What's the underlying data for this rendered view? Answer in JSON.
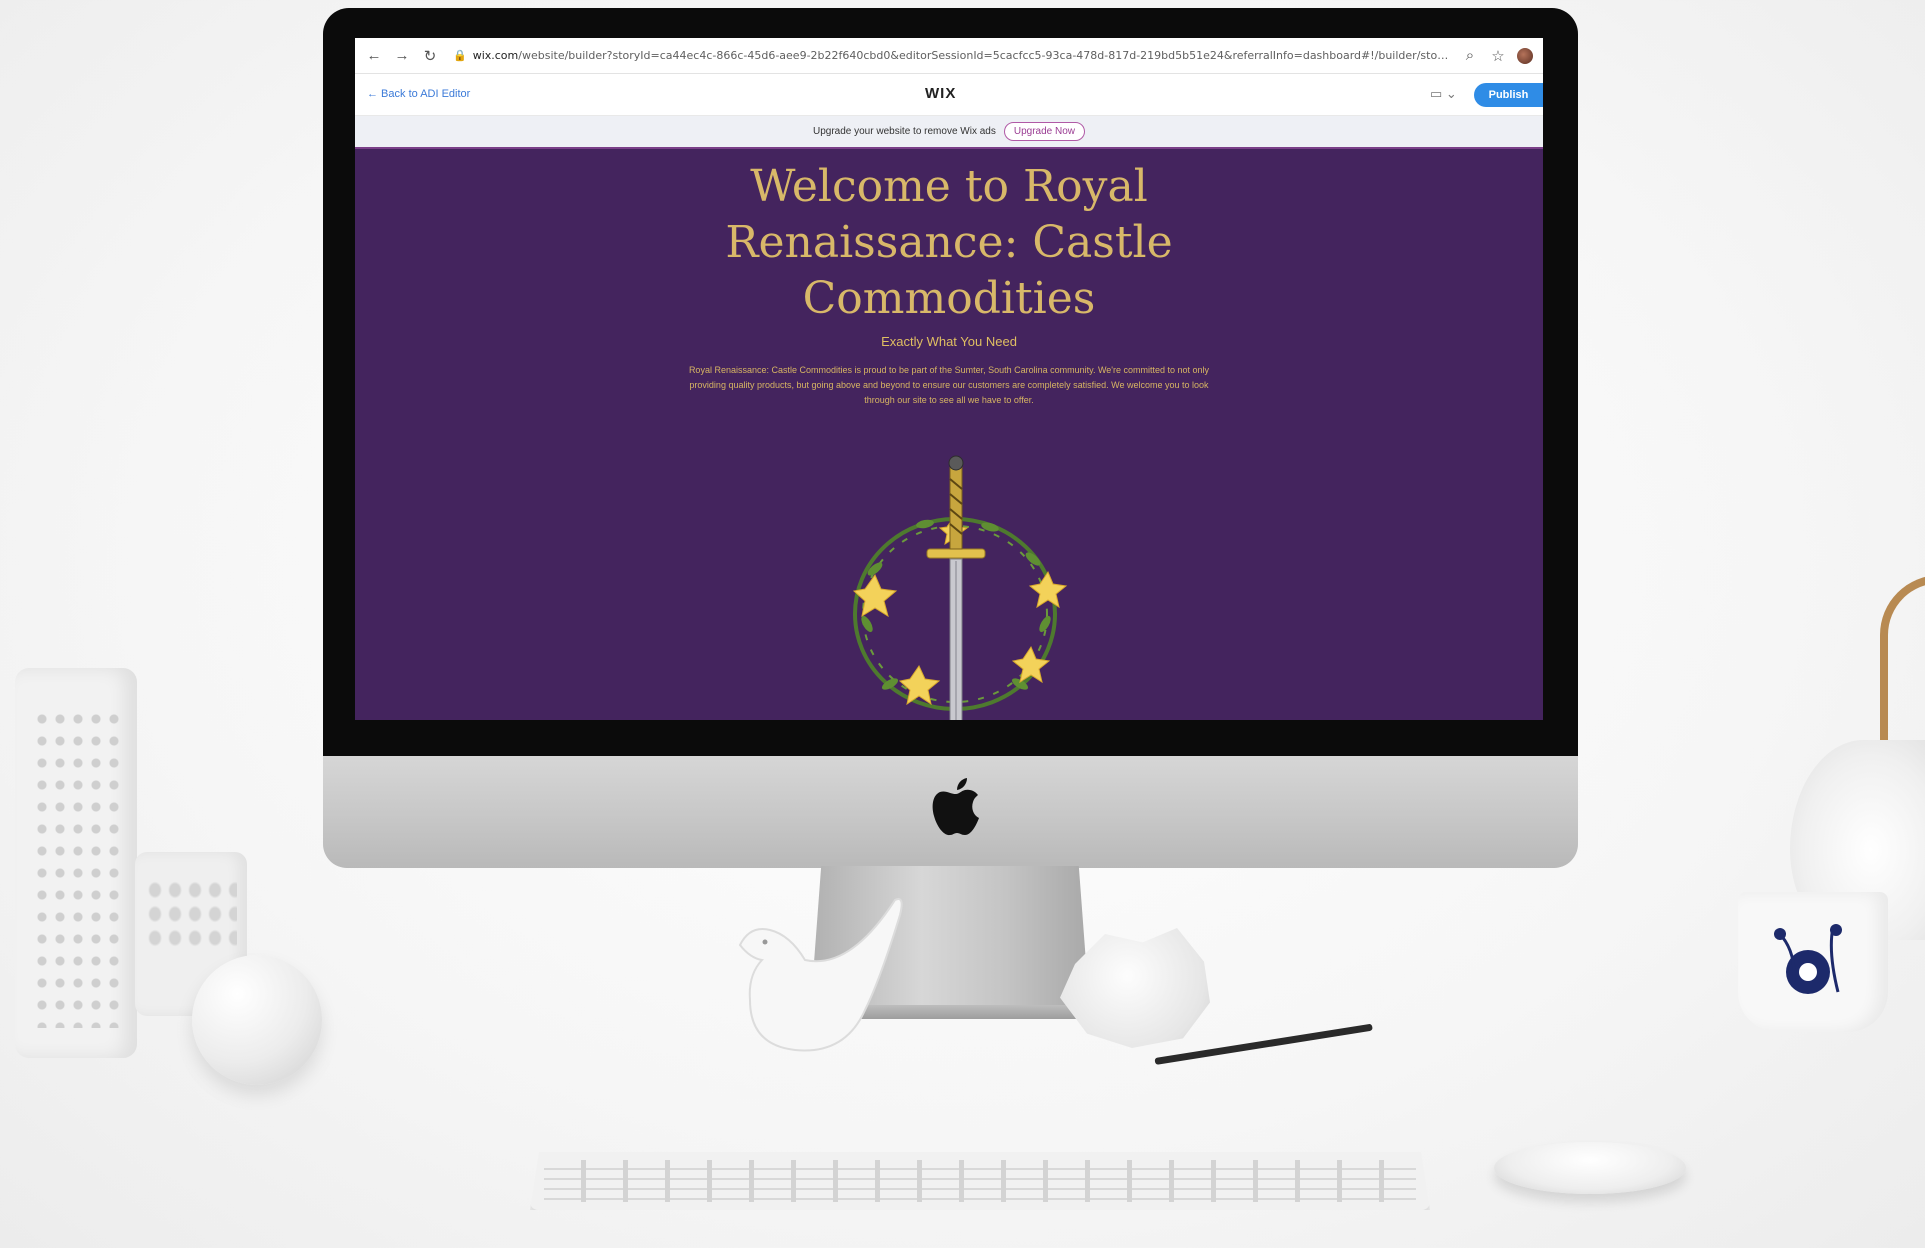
{
  "browser": {
    "url_host": "wix.com",
    "url_rest": "/website/builder?storyId=ca44ec4c-866c-45d6-aee9-2b22f640cbd0&editorSessionId=5cacfcc5-93ca-478d-817d-219bd5b51e24&referralInfo=dashboard#!/builder/story/ca44ec...",
    "icons": [
      "back-arrow-icon",
      "forward-arrow-icon",
      "reload-icon",
      "lock-icon",
      "zoom-icon",
      "star-icon",
      "profile-avatar"
    ]
  },
  "editor": {
    "back_label": "← Back to ADI Editor",
    "logo": "WIX",
    "device_toggle": "▭ ⌄",
    "publish_label": "Publish"
  },
  "ad_banner": {
    "text": "Upgrade your website to remove Wix ads",
    "button_label": "Upgrade Now"
  },
  "site": {
    "title": "Welcome to Royal Renaissance: Castle Commodities",
    "subtitle": "Exactly What You Need",
    "body": "Royal Renaissance: Castle Commodities is proud to be part of the Sumter, South Carolina community. We're committed to not only providing quality products, but going above and beyond to ensure our customers are completely satisfied. We welcome you to look through our site to see all we have to offer.",
    "emblem": "sword-flower-wreath"
  },
  "colors": {
    "site_background": "#44245e",
    "title_gold": "#d8b869",
    "publish_blue": "#2f8ce6",
    "upgrade_purple": "#9a3c93"
  }
}
